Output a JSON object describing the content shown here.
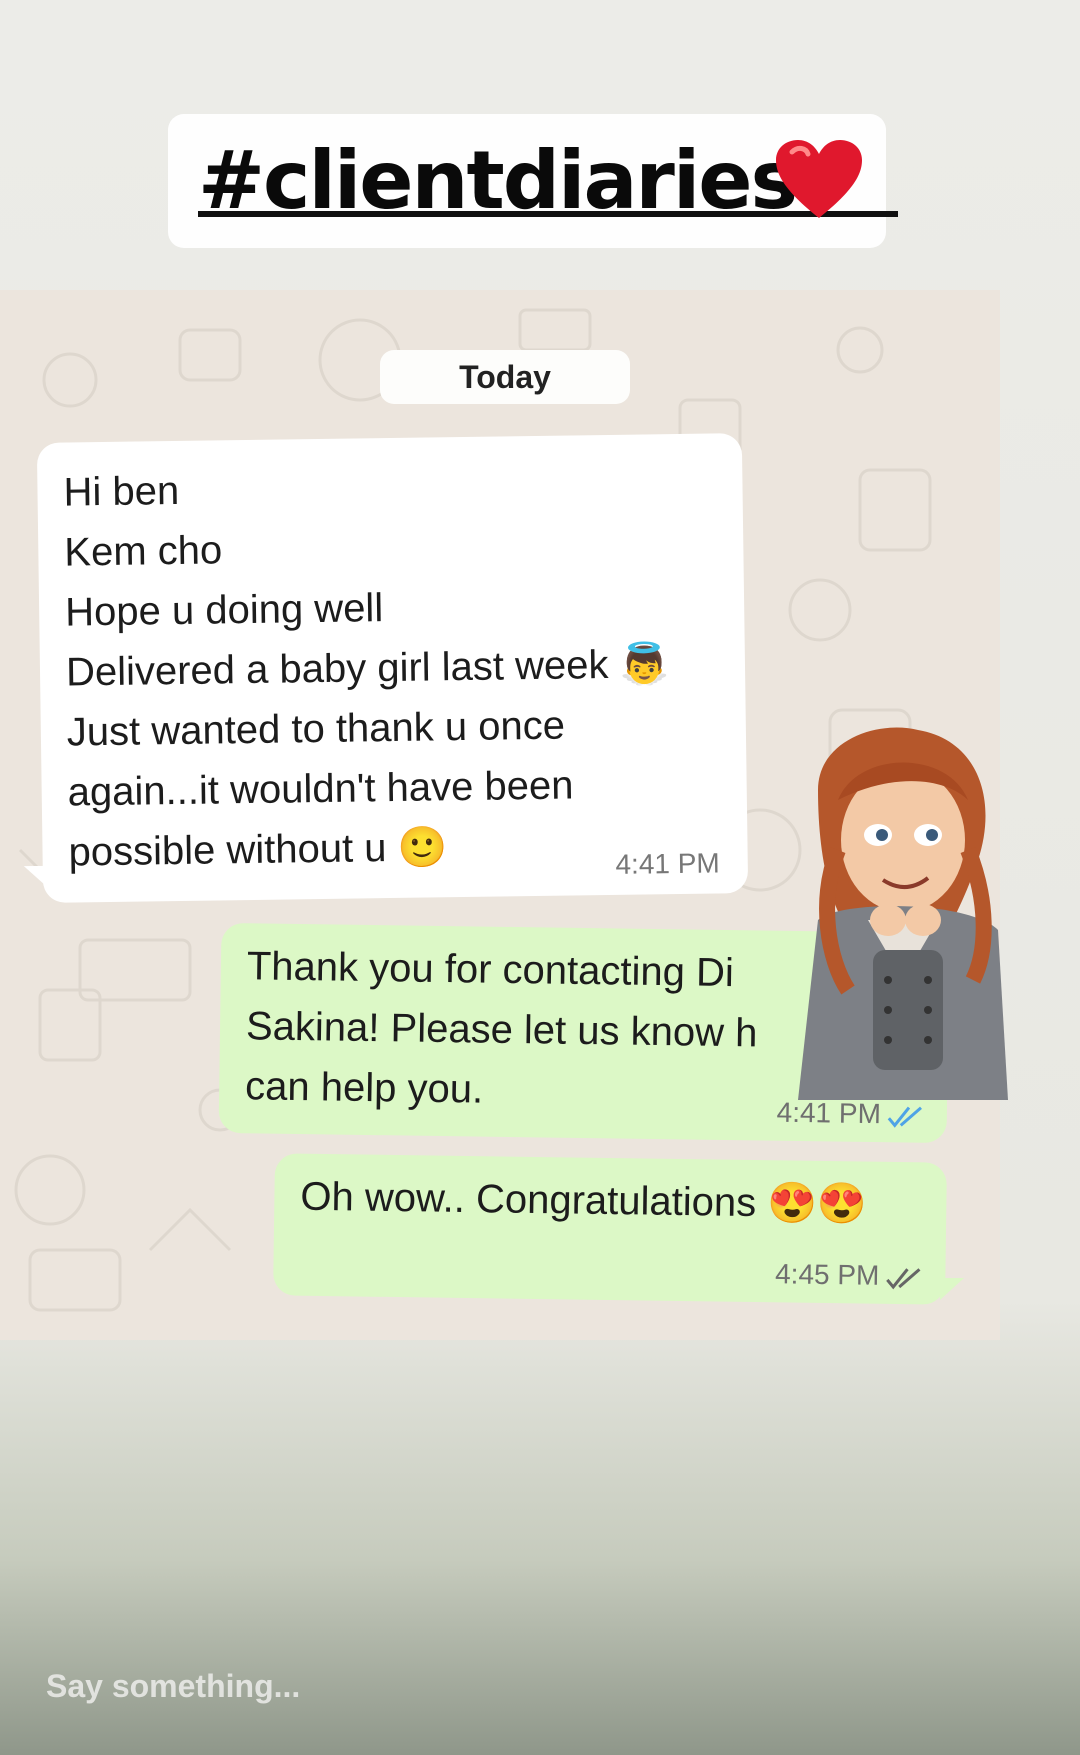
{
  "story": {
    "title": "#clientdiaries",
    "input_placeholder": "Say something..."
  },
  "chat": {
    "date_label": "Today",
    "messages": [
      {
        "direction": "incoming",
        "lines": [
          "Hi ben",
          "Kem cho",
          "Hope u doing well",
          "Delivered a baby girl last week 👼",
          "Just wanted to thank u once",
          "again...it wouldn't have been",
          "possible without u 🙂"
        ],
        "time": "4:41 PM"
      },
      {
        "direction": "outgoing",
        "lines": [
          "Thank you for contacting Di",
          "Sakina! Please let us know h",
          "can help you."
        ],
        "time": "4:41 PM",
        "status_icon": "double-check-read-icon"
      },
      {
        "direction": "outgoing",
        "lines": [
          "Oh wow.. Congratulations 😍😍"
        ],
        "time": "4:45 PM",
        "status_icon": "double-check-delivered-icon"
      }
    ]
  },
  "colors": {
    "incoming_bubble": "#ffffff",
    "outgoing_bubble": "#dcf8c6",
    "chat_background": "#ece5dd",
    "read_check": "#4fa3e6",
    "delivered_check": "#888888",
    "heart": "#e0182d"
  },
  "sticker": {
    "icon": "girl-cartoon-sticker"
  }
}
